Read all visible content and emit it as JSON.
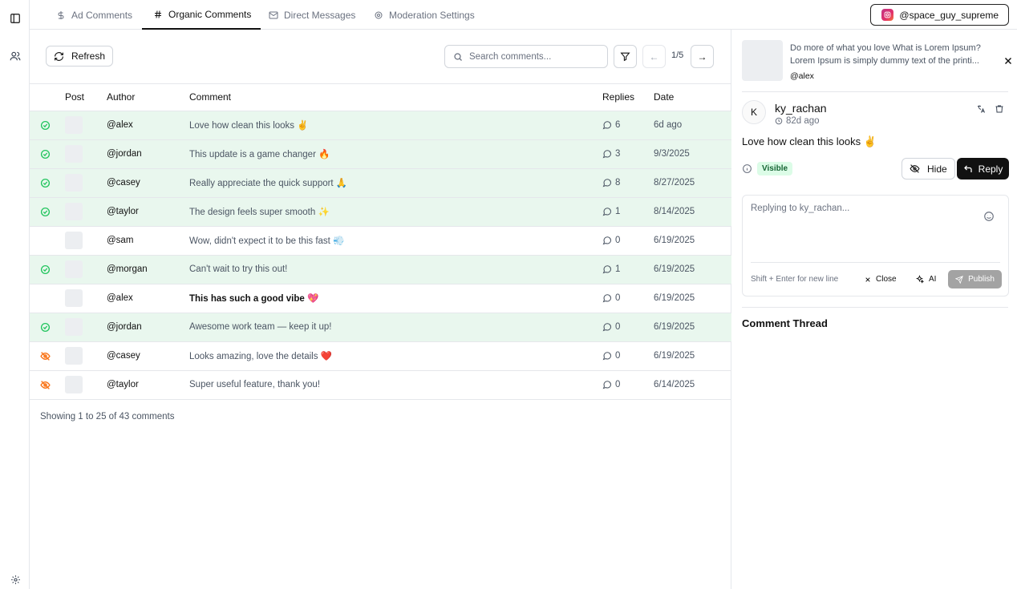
{
  "rail": {
    "icons": [
      "sidebar-toggle-icon",
      "users-icon",
      "settings-icon"
    ]
  },
  "tabs": [
    {
      "label": "Ad Comments",
      "icon": "dollar-icon"
    },
    {
      "label": "Organic Comments",
      "icon": "hash-icon",
      "active": true
    },
    {
      "label": "Direct Messages",
      "icon": "mail-icon"
    },
    {
      "label": "Moderation Settings",
      "icon": "gear-icon"
    }
  ],
  "account": {
    "handle": "@space_guy_supreme",
    "icon": "instagram-icon"
  },
  "toolbar": {
    "refresh_label": "Refresh",
    "search_placeholder": "Search comments...",
    "page_indicator": "1/5",
    "prev_label": "←",
    "next_label": "→"
  },
  "table": {
    "headers": {
      "post": "Post",
      "author": "Author",
      "comment": "Comment",
      "replies": "Replies",
      "date": "Date"
    },
    "rows": [
      {
        "status": "visible",
        "author": "@alex",
        "comment": "Love how clean this looks ✌️",
        "replies": "6",
        "date": "6d ago"
      },
      {
        "status": "visible",
        "author": "@jordan",
        "comment": "This update is a game changer 🔥",
        "replies": "3",
        "date": "9/3/2025"
      },
      {
        "status": "visible",
        "author": "@casey",
        "comment": "Really appreciate the quick support 🙏",
        "replies": "8",
        "date": "8/27/2025"
      },
      {
        "status": "visible",
        "author": "@taylor",
        "comment": "The design feels super smooth ✨",
        "replies": "1",
        "date": "8/14/2025"
      },
      {
        "status": "none",
        "author": "@sam",
        "comment": "Wow, didn't expect it to be this fast 💨",
        "replies": "0",
        "date": "6/19/2025"
      },
      {
        "status": "visible",
        "author": "@morgan",
        "comment": "Can't wait to try this out!",
        "replies": "1",
        "date": "6/19/2025"
      },
      {
        "status": "none",
        "author": "@alex",
        "comment": "This has such a good vibe 💖",
        "replies": "0",
        "date": "6/19/2025",
        "unread": true
      },
      {
        "status": "visible",
        "author": "@jordan",
        "comment": "Awesome work team — keep it up!",
        "replies": "0",
        "date": "6/19/2025"
      },
      {
        "status": "hidden",
        "author": "@casey",
        "comment": "Looks amazing, love the details ❤️",
        "replies": "0",
        "date": "6/19/2025"
      },
      {
        "status": "hidden",
        "author": "@taylor",
        "comment": "Super useful feature, thank you!",
        "replies": "0",
        "date": "6/14/2025"
      }
    ],
    "footer": "Showing 1 to 25 of 43 comments"
  },
  "colors": {
    "visible": "#22c55e",
    "hidden": "#f97316",
    "accent": "#111111"
  },
  "panel": {
    "post": {
      "text": "Do more of what you love What is Lorem Ipsum? Lorem Ipsum is simply dummy text of the printi...",
      "author": "@alex"
    },
    "comment": {
      "avatar_letter": "K",
      "username": "ky_rachan",
      "time": "82d ago",
      "body": "Love how clean this looks ✌️",
      "status_badge": "Visible"
    },
    "hide_label": "Hide",
    "reply_label": "Reply",
    "reply_box": {
      "placeholder": "Replying to ky_rachan...",
      "hint": "Shift + Enter for new line",
      "close_label": "Close",
      "ai_label": "AI",
      "publish_label": "Publish"
    },
    "thread_title": "Comment Thread"
  }
}
